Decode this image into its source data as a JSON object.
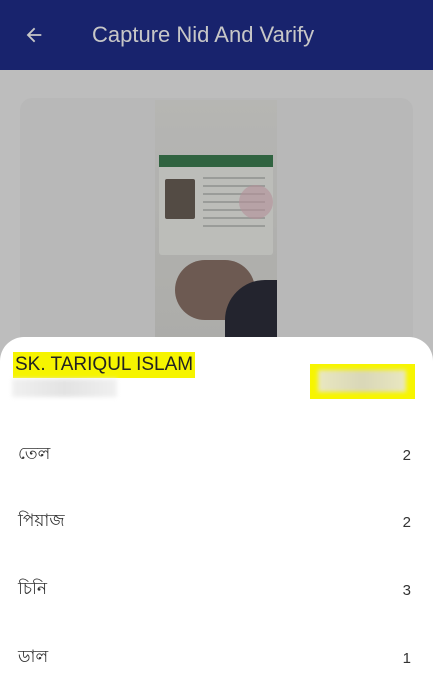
{
  "header": {
    "title": "Capture Nid And Varify",
    "back_icon": "arrow-left-icon"
  },
  "colors": {
    "app_bar": "#1f2d8c",
    "highlight": "#f6f400",
    "sheet": "#ffffff"
  },
  "preview": {
    "image_label": "nid-card-photo"
  },
  "sheet": {
    "customer_name": "SK. TARIQUL ISLAM",
    "items": [
      {
        "name": "তেল",
        "qty": "2"
      },
      {
        "name": "পিয়াজ",
        "qty": "2"
      },
      {
        "name": "চিনি",
        "qty": "3"
      },
      {
        "name": "ডাল",
        "qty": "1"
      }
    ]
  }
}
